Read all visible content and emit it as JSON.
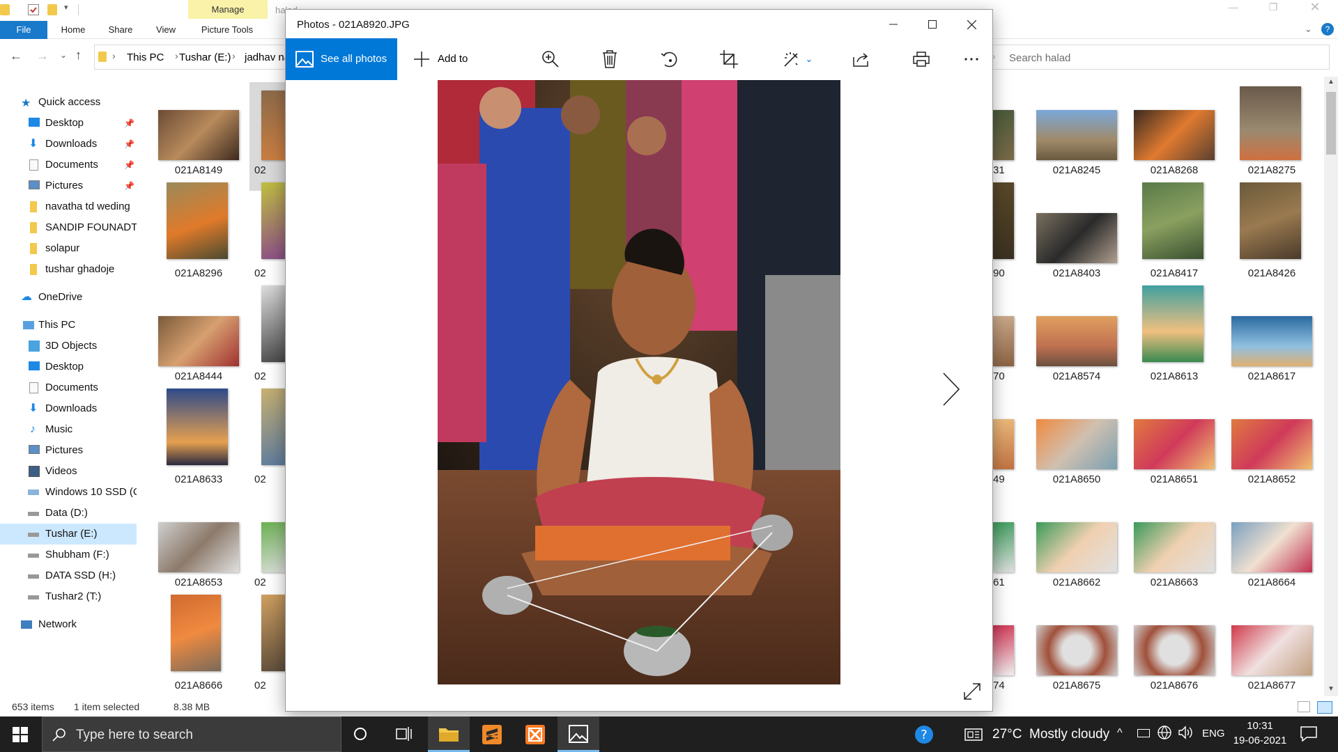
{
  "explorer": {
    "title_partial": "halad",
    "ribbon": {
      "file": "File",
      "tabs": [
        "Home",
        "Share",
        "View",
        "Picture Tools"
      ],
      "manage": "Manage"
    },
    "address": [
      "This PC",
      "Tushar (E:)",
      "jadhav na"
    ],
    "search_placeholder": "Search halad",
    "nav": {
      "quick_access": "Quick access",
      "quick_items": [
        "Desktop",
        "Downloads",
        "Documents",
        "Pictures",
        "navatha td weding",
        "SANDIP FOUNADTI(",
        "solapur",
        "tushar ghadoje"
      ],
      "onedrive": "OneDrive",
      "this_pc": "This PC",
      "pc_items": [
        "3D Objects",
        "Desktop",
        "Documents",
        "Downloads",
        "Music",
        "Pictures",
        "Videos",
        "Windows 10 SSD (C",
        "Data (D:)",
        "Tushar (E:)",
        "Shubham (F:)",
        "DATA SSD (H:)",
        "Tushar2 (T:)"
      ],
      "network": "Network"
    },
    "left_thumbs": [
      "021A8149",
      "021A8296",
      "021A8444",
      "021A8633",
      "021A8653",
      "021A8666"
    ],
    "partial_col": [
      "02",
      "02",
      "02",
      "02",
      "02",
      "02"
    ],
    "right_partial": [
      "31",
      "90",
      "70",
      "49",
      "61",
      "74"
    ],
    "right_grid": [
      [
        "021A8245",
        "021A8268",
        "021A8275"
      ],
      [
        "021A8403",
        "021A8417",
        "021A8426"
      ],
      [
        "021A8574",
        "021A8613",
        "021A8617"
      ],
      [
        "021A8650",
        "021A8651",
        "021A8652"
      ],
      [
        "021A8662",
        "021A8663",
        "021A8664"
      ],
      [
        "021A8675",
        "021A8676",
        "021A8677"
      ]
    ],
    "status": {
      "count": "653 items",
      "selected": "1 item selected",
      "size": "8.38 MB"
    }
  },
  "photos": {
    "title": "Photos - 021A8920.JPG",
    "see_all": "See all photos",
    "add_to": "Add to"
  },
  "taskbar": {
    "search": "Type here to search",
    "weather": "27°C  Mostly cloudy",
    "lang": "ENG",
    "time": "10:31",
    "date": "19-06-2021"
  }
}
